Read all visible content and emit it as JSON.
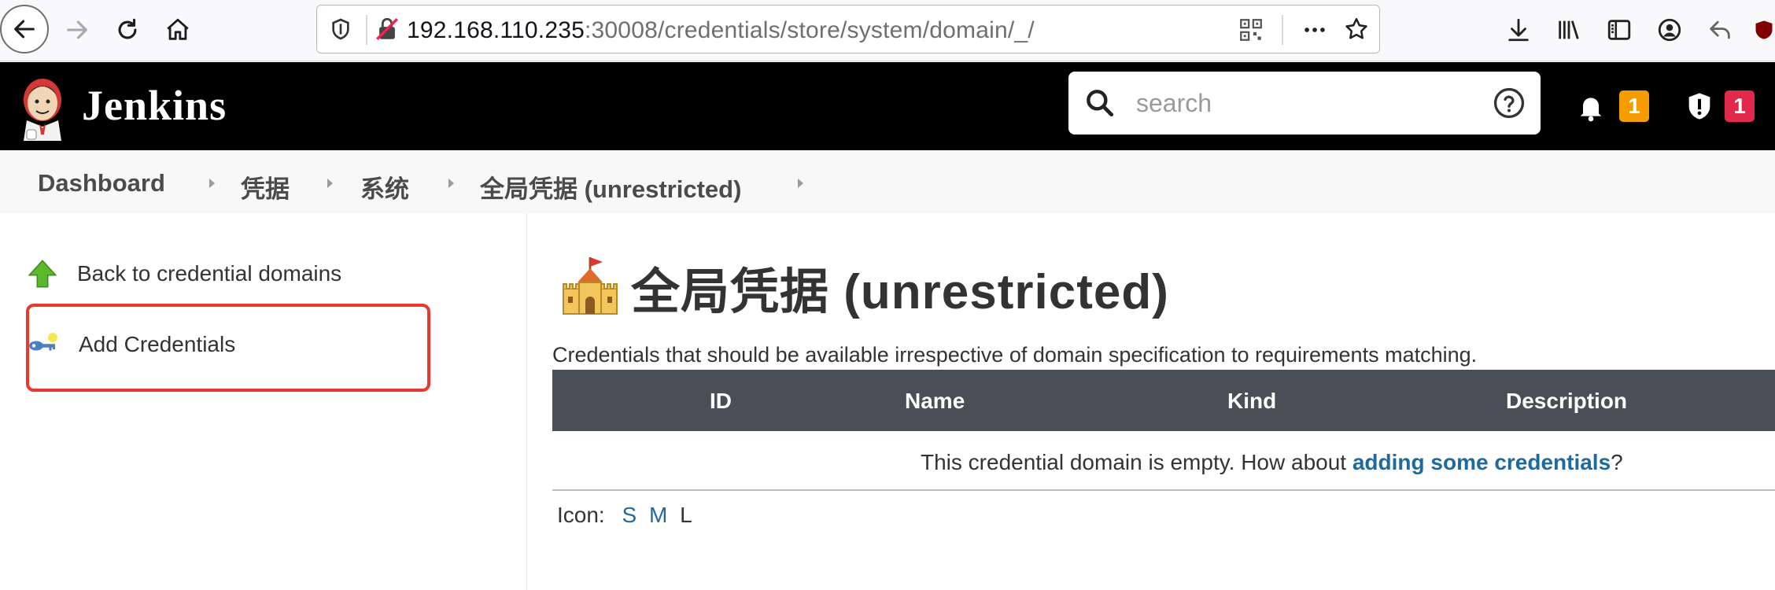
{
  "browser": {
    "url_host": "192.168.110.235",
    "url_path": ":30008/credentials/store/system/domain/_/"
  },
  "header": {
    "title": "Jenkins",
    "search_placeholder": "search",
    "notifications_count": "1",
    "security_count": "1",
    "colors": {
      "notification_badge": "#f59d00",
      "security_badge": "#e0294b"
    }
  },
  "breadcrumb": {
    "items": [
      {
        "label": "Dashboard"
      },
      {
        "label": "凭据"
      },
      {
        "label": "系统"
      },
      {
        "label": "全局凭据 (unrestricted)"
      }
    ]
  },
  "sidebar": {
    "items": [
      {
        "label": "Back to credential domains",
        "icon": "green-up-arrow-icon"
      },
      {
        "label": "Add Credentials",
        "icon": "key-icon"
      }
    ]
  },
  "main": {
    "title": "全局凭据 (unrestricted)",
    "description": "Credentials that should be available irrespective of domain specification to requirements matching.",
    "table": {
      "columns": [
        "ID",
        "Name",
        "Kind",
        "Description"
      ],
      "empty_prefix": "This credential domain is empty. How about ",
      "empty_link": "adding some credentials",
      "empty_suffix": "?"
    },
    "icon_size": {
      "label": "Icon:",
      "sizes": [
        "S",
        "M",
        "L"
      ]
    }
  }
}
